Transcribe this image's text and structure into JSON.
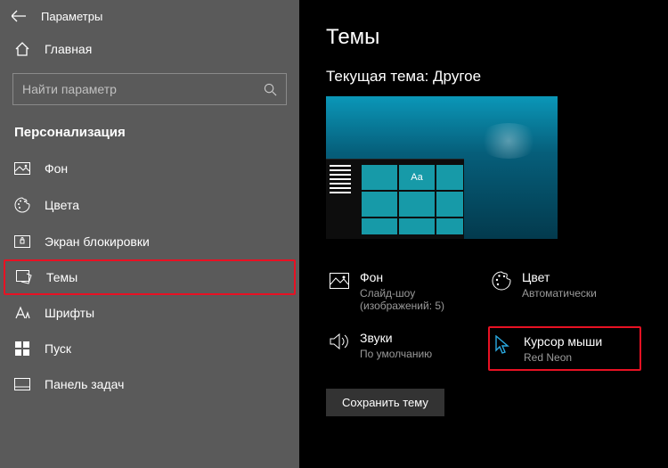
{
  "titlebar": {
    "title": "Параметры"
  },
  "home": {
    "label": "Главная"
  },
  "search": {
    "placeholder": "Найти параметр"
  },
  "section": {
    "title": "Персонализация"
  },
  "nav": {
    "items": [
      {
        "label": "Фон"
      },
      {
        "label": "Цвета"
      },
      {
        "label": "Экран блокировки"
      },
      {
        "label": "Темы"
      },
      {
        "label": "Шрифты"
      },
      {
        "label": "Пуск"
      },
      {
        "label": "Панель задач"
      }
    ]
  },
  "page": {
    "title": "Темы",
    "current_theme_label": "Текущая тема:",
    "current_theme_value": "Другое",
    "preview_sample": "Aa",
    "save_button": "Сохранить тему"
  },
  "tiles": {
    "background": {
      "label": "Фон",
      "value": "Слайд-шоу (изображений: 5)"
    },
    "color": {
      "label": "Цвет",
      "value": "Автоматически"
    },
    "sounds": {
      "label": "Звуки",
      "value": "По умолчанию"
    },
    "cursor": {
      "label": "Курсор мыши",
      "value": "Red Neon"
    }
  }
}
